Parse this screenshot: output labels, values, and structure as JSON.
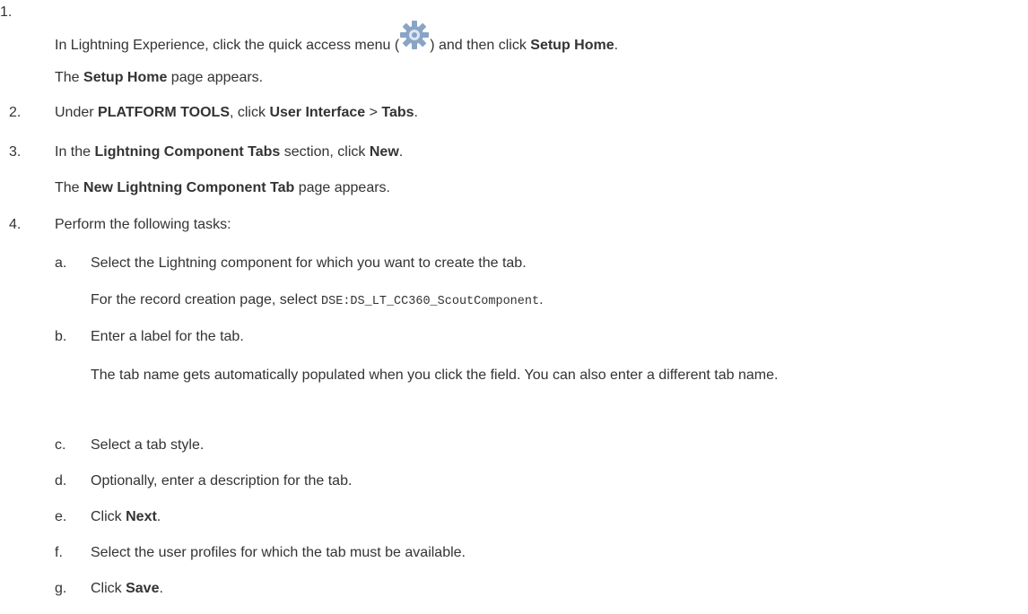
{
  "steps": {
    "s1": {
      "num": "1.",
      "pre": "In Lightning Experience, click the quick access menu (",
      "mid": ") and then click ",
      "bold": "Setup Home",
      "end": ".",
      "icon": "gear-icon",
      "result_bold": "Setup Home",
      "result_end": " page appears.",
      "result_pre": "The "
    },
    "s2": {
      "num": "2.",
      "pre": "Under ",
      "b1": "PLATFORM TOOLS",
      "mid1": ", click ",
      "b2": "User Interface",
      "mid2": " > ",
      "b3": "Tabs",
      "end": "."
    },
    "s3": {
      "num": "3.",
      "pre": "In the ",
      "b1": "Lightning Component Tabs",
      "mid": " section, click ",
      "b2": "New",
      "end": ".",
      "result_pre": "The ",
      "result_bold": "New Lightning Component Tab",
      "result_end": " page appears."
    },
    "s4": {
      "num": "4.",
      "text": "Perform the following tasks:",
      "a": {
        "letter": "a.",
        "text": "Select the Lightning component for which you want to create the tab.",
        "detail_pre": "For the record creation page, select ",
        "detail_code": "DSE:DS_LT_CC360_ScoutComponent",
        "detail_end": "."
      },
      "b": {
        "letter": "b.",
        "text": "Enter a label for the tab.",
        "detail": "The tab name gets automatically populated when you click the field. You can also enter a different tab name."
      },
      "c": {
        "letter": "c.",
        "text": "Select a tab style."
      },
      "d": {
        "letter": "d.",
        "text": "Optionally, enter a description for the tab."
      },
      "e": {
        "letter": "e.",
        "pre": "Click ",
        "bold": "Next",
        "end": "."
      },
      "f": {
        "letter": "f.",
        "text": "Select the user profiles for which the tab must be available."
      },
      "g": {
        "letter": "g.",
        "pre": "Click ",
        "bold": "Save",
        "end": "."
      }
    }
  },
  "colors": {
    "text": "#333333",
    "gear": "#8aa4c8"
  }
}
